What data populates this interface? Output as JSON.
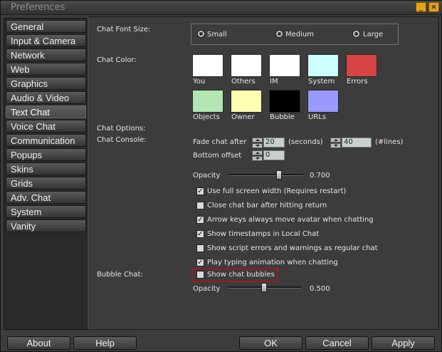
{
  "window": {
    "title": "Preferences"
  },
  "sidebar": {
    "tabs": [
      {
        "label": "General"
      },
      {
        "label": "Input & Camera"
      },
      {
        "label": "Network"
      },
      {
        "label": "Web"
      },
      {
        "label": "Graphics"
      },
      {
        "label": "Audio & Video"
      },
      {
        "label": "Text Chat"
      },
      {
        "label": "Voice Chat"
      },
      {
        "label": "Communication"
      },
      {
        "label": "Popups"
      },
      {
        "label": "Skins"
      },
      {
        "label": "Grids"
      },
      {
        "label": "Adv. Chat"
      },
      {
        "label": "System"
      },
      {
        "label": "Vanity"
      }
    ],
    "active_tab": "Text Chat"
  },
  "chat_font_size": {
    "label": "Chat Font Size:",
    "options": [
      "Small",
      "Medium",
      "Large"
    ]
  },
  "chat_color": {
    "label": "Chat Color:",
    "swatches": [
      {
        "label": "You",
        "color": "#ffffff"
      },
      {
        "label": "Others",
        "color": "#ffffff"
      },
      {
        "label": "IM",
        "color": "#ffffff"
      },
      {
        "label": "System",
        "color": "#ccffff"
      },
      {
        "label": "Errors",
        "color": "#d64444"
      },
      {
        "label": "Objects",
        "color": "#b3e6b3"
      },
      {
        "label": "Owner",
        "color": "#ffffb3"
      },
      {
        "label": "Bubble",
        "color": "#000000"
      },
      {
        "label": "URLs",
        "color": "#9999ff"
      }
    ]
  },
  "chat_options": {
    "label": "Chat Options:"
  },
  "chat_console": {
    "label": "Chat Console:",
    "fade_label": "Fade chat after",
    "fade_value": "20",
    "seconds_label": "(seconds)",
    "lines_value": "40",
    "lines_label": "(#lines)",
    "bottom_offset_label": "Bottom offset",
    "bottom_offset_value": "0",
    "opacity_label": "Opacity",
    "opacity_value": "0.700"
  },
  "checkboxes": [
    {
      "label": "Use full screen width (Requires restart)",
      "checked": true
    },
    {
      "label": "Close chat bar after hitting return",
      "checked": false
    },
    {
      "label": "Arrow keys always move avatar when chatting",
      "checked": true
    },
    {
      "label": "Show timestamps in Local Chat",
      "checked": true
    },
    {
      "label": "Show script errors and warnings as regular chat",
      "checked": false
    },
    {
      "label": "Play typing animation when chatting",
      "checked": true
    }
  ],
  "bubble_chat": {
    "label": "Bubble Chat:",
    "show_label": "Show chat bubbles",
    "show_checked": false,
    "opacity_label": "Opacity",
    "opacity_value": "0.500"
  },
  "buttons": {
    "about": "About",
    "help": "Help",
    "ok": "OK",
    "cancel": "Cancel",
    "apply": "Apply"
  }
}
